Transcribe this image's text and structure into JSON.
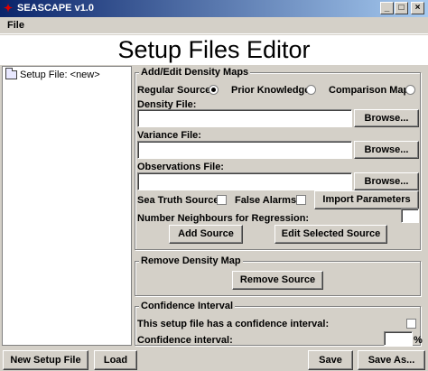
{
  "window": {
    "title": "SEASCAPE v1.0",
    "min": "_",
    "max": "□",
    "close": "×"
  },
  "menu": {
    "file": "File"
  },
  "page_title": "Setup Files Editor",
  "tree": {
    "item": "Setup File: <new>"
  },
  "density": {
    "group_title": "Add/Edit Density Maps",
    "regular_source": "Regular Source:",
    "prior_knowledge": "Prior Knowledge:",
    "comparison_map": "Comparison Map:",
    "density_file": "Density File:",
    "variance_file": "Variance File:",
    "observations_file": "Observations File:",
    "browse": "Browse...",
    "sea_truth": "Sea Truth Source",
    "false_alarms": "False Alarms",
    "import_params": "Import Parameters",
    "neighbours": "Number Neighbours for Regression:",
    "add_source": "Add Source",
    "edit_source": "Edit Selected Source"
  },
  "remove": {
    "group_title": "Remove Density Map",
    "button": "Remove Source"
  },
  "confidence": {
    "group_title": "Confidence Interval",
    "has_interval": "This setup file has a confidence interval:",
    "interval": "Confidence interval:",
    "percent": "%"
  },
  "bottom": {
    "new_file": "New Setup File",
    "load": "Load",
    "save": "Save",
    "save_as": "Save As..."
  }
}
